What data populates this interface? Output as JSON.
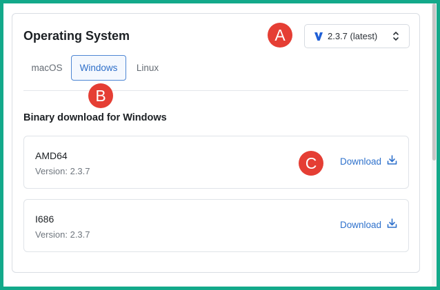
{
  "header": {
    "title": "Operating System",
    "version_select": {
      "value": "2.3.7 (latest)",
      "icon": "v-logo-icon",
      "chevron": "chevron-up-down-icon"
    }
  },
  "tabs": [
    {
      "label": "macOS",
      "selected": false
    },
    {
      "label": "Windows",
      "selected": true
    },
    {
      "label": "Linux",
      "selected": false
    }
  ],
  "section": {
    "title": "Binary download for Windows"
  },
  "downloads": [
    {
      "arch": "AMD64",
      "version": "Version: 2.3.7",
      "link": "Download",
      "icon": "download-icon"
    },
    {
      "arch": "I686",
      "version": "Version: 2.3.7",
      "link": "Download",
      "icon": "download-icon"
    }
  ],
  "markers": {
    "a": "A",
    "b": "B",
    "c": "C"
  },
  "colors": {
    "accent": "#2e71cc",
    "marker": "#e53e34",
    "frame": "#13a98a",
    "logo": "#1f5fd6"
  }
}
